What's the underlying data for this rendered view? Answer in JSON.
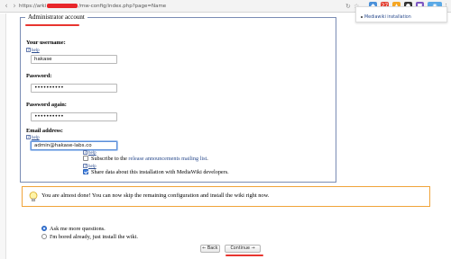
{
  "browser": {
    "url_prefix": "https://arki",
    "url_suffix": "/mw-config/index.php?page=Name",
    "back_icon": "chevron-left-icon",
    "forward_icon": "chevron-right-icon",
    "dropdown_item": "Mediawiki installation"
  },
  "form": {
    "legend": "Administrator account",
    "username_label": "Your username:",
    "username_value": "hakase",
    "password_label": "Password:",
    "password_value": "••••••••••",
    "password_again_label": "Password again:",
    "password_again_value": "••••••••••",
    "email_label": "Email address:",
    "email_value": "admin@hakase-labs.co",
    "help_text": "help",
    "subscribe_prefix": "Subscribe to the ",
    "subscribe_link": "release announcements mailing list",
    "subscribe_suffix": ".",
    "subscribe_checked": false,
    "share_label": "Share data about this installation with MediaWiki developers.",
    "share_checked": true
  },
  "notice": {
    "text": "You are almost done! You can now skip the remaining configuration and install the wiki right now."
  },
  "options": {
    "ask_more": "Ask me more questions.",
    "bored": "I'm bored already, just install the wiki.",
    "selected": "ask_more"
  },
  "buttons": {
    "back": "← Back",
    "continue": "Continue →"
  },
  "colors": {
    "annotation_underline": "#e8352f",
    "link": "#2a4b8d",
    "notice_border": "#f0a43a",
    "fieldset_border": "#7a8cb4"
  }
}
